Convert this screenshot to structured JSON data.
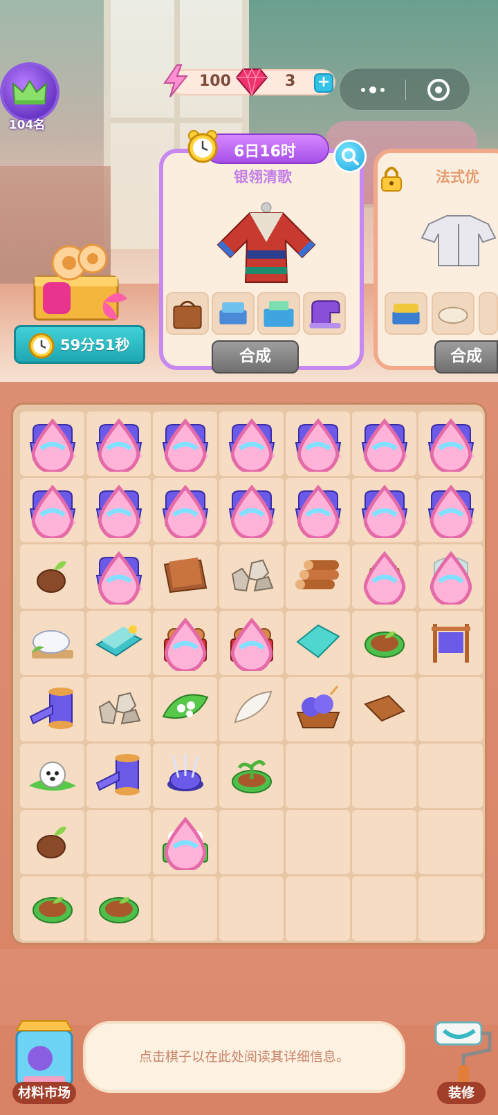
{
  "rank": {
    "label": "104名",
    "icon": "crown-icon"
  },
  "currency": {
    "energy": "100",
    "gems": "3",
    "plus": "+"
  },
  "gift": {
    "timer": "59分51秒"
  },
  "recipes": [
    {
      "timer": "6日16时",
      "title": "银翎清歌",
      "craft_label": "合成",
      "locked": false
    },
    {
      "title": "法式优",
      "craft_label": "合成",
      "locked": true
    }
  ],
  "bottom": {
    "market_label": "材料市场",
    "decor_label": "装修",
    "info_text": "点击棋子以在此处阅读其详细信息。"
  },
  "board": {
    "rows": [
      [
        "sewing-kit",
        "sewing-kit",
        "sewing-kit",
        "sewing-kit",
        "sewing-kit",
        "sewing-kit",
        "sewing-kit"
      ],
      [
        "sewing-kit",
        "sewing-kit",
        "sewing-kit",
        "sewing-kit",
        "sewing-kit",
        "sewing-kit",
        "sewing-kit"
      ],
      [
        "seed",
        "sewing-kit",
        "leather",
        "stones",
        "logs",
        "seed-sack",
        "sprout-box"
      ],
      [
        "silk-cocoon",
        "fabric-roll",
        "log-crate",
        "log-crate",
        "cloth",
        "soil-bowl",
        "loom"
      ],
      [
        "thread-spool",
        "stones",
        "cotton-leaf",
        "feather",
        "yarn-basket",
        "leather-scrap",
        ""
      ],
      [
        "sheep",
        "thread-spool",
        "pincushion",
        "sprout-bowl",
        "",
        "",
        ""
      ],
      [
        "seed",
        "",
        "cotton-plant",
        "",
        "",
        "",
        ""
      ],
      [
        "soil-bowl",
        "soil-bowl",
        "",
        "",
        "",
        "",
        ""
      ]
    ]
  }
}
